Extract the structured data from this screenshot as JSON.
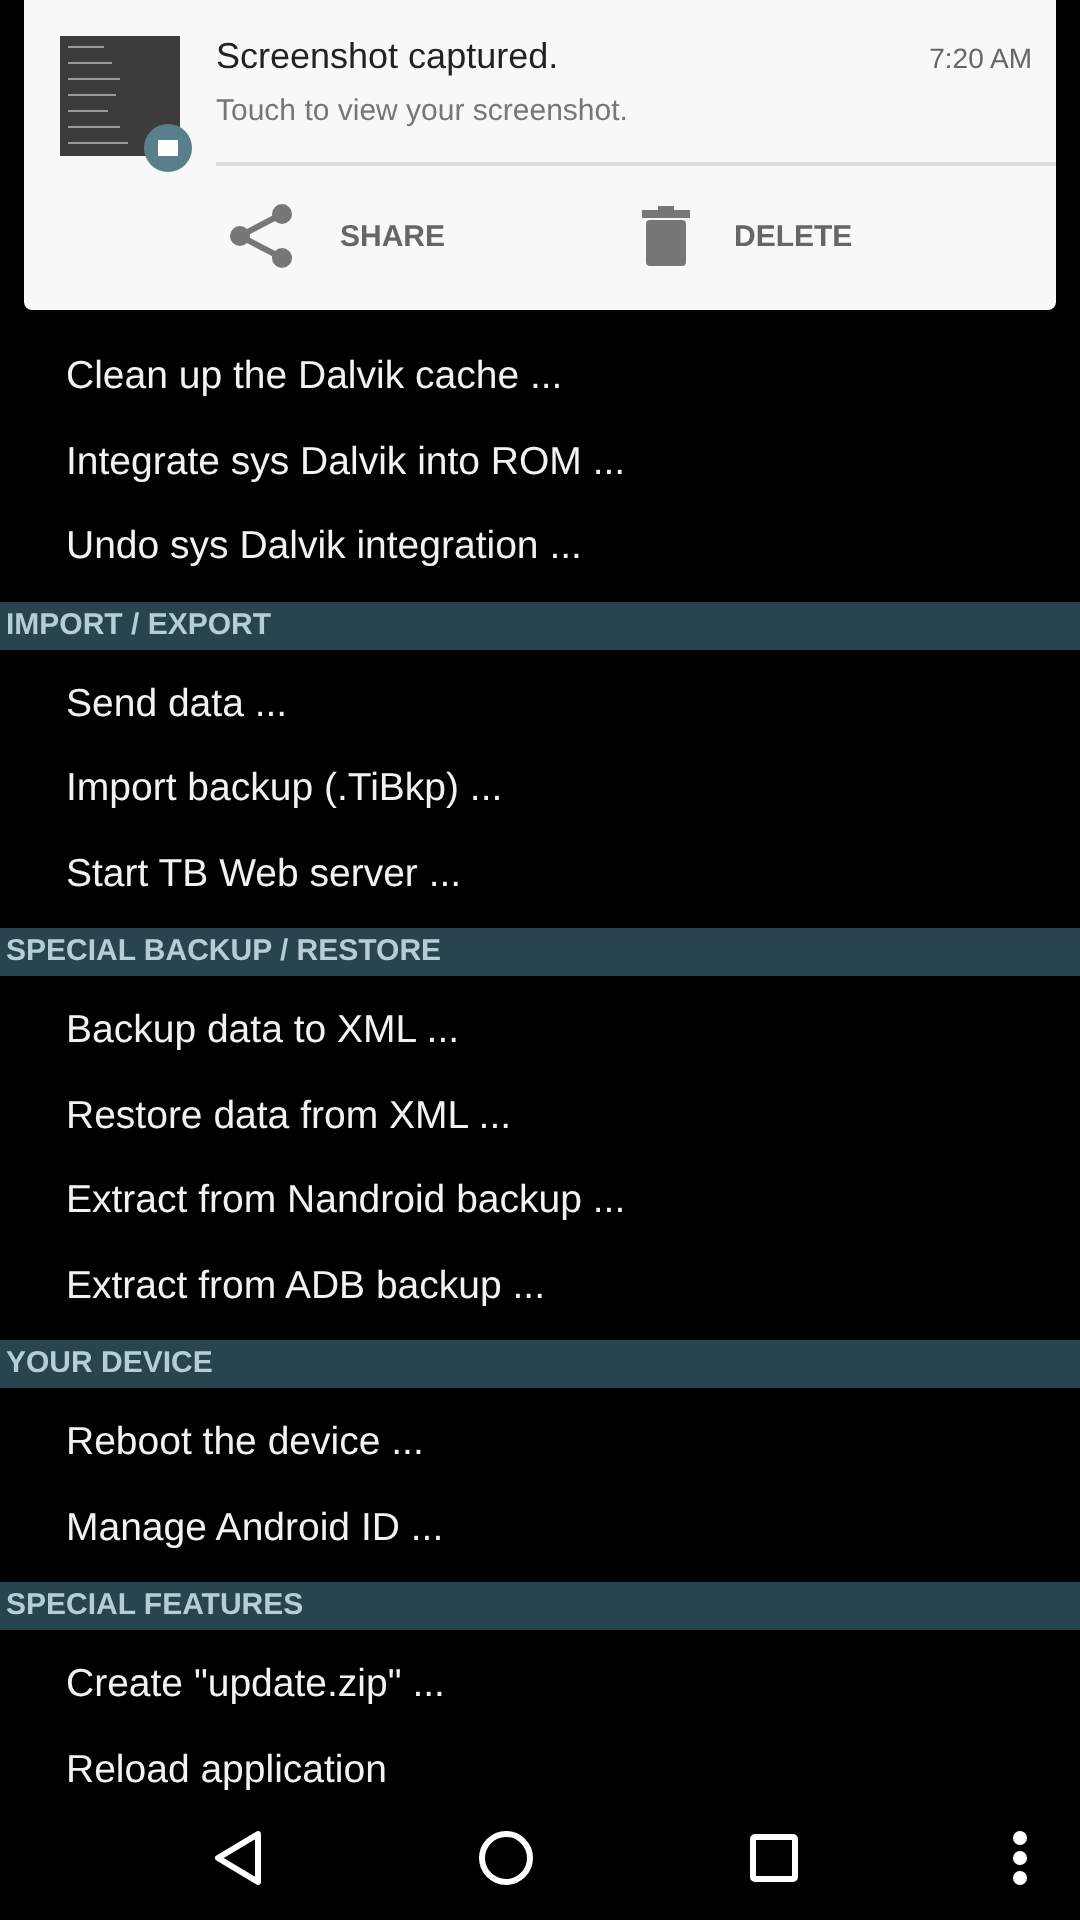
{
  "notification": {
    "title": "Screenshot captured.",
    "time": "7:20 AM",
    "text": "Touch to view your screenshot.",
    "actions": [
      {
        "kind": "share",
        "label": "SHARE"
      },
      {
        "kind": "delete",
        "label": "DELETE"
      }
    ]
  },
  "sections": [
    {
      "items": [
        "Clean up the Dalvik cache ...",
        "Integrate sys Dalvik into ROM ...",
        "Undo sys Dalvik integration ..."
      ]
    },
    {
      "title": "IMPORT / EXPORT",
      "items": [
        "Send data ...",
        "Import backup (.TiBkp) ...",
        "Start TB Web server ..."
      ]
    },
    {
      "title": "SPECIAL BACKUP / RESTORE",
      "items": [
        "Backup data to XML ...",
        "Restore data from XML ...",
        "Extract from Nandroid backup ...",
        "Extract from ADB backup ..."
      ]
    },
    {
      "title": "YOUR DEVICE",
      "items": [
        "Reboot the device ...",
        "Manage Android ID ..."
      ]
    },
    {
      "title": "SPECIAL FEATURES",
      "items": [
        "Create \"update.zip\" ...",
        "Reload application"
      ]
    }
  ]
}
